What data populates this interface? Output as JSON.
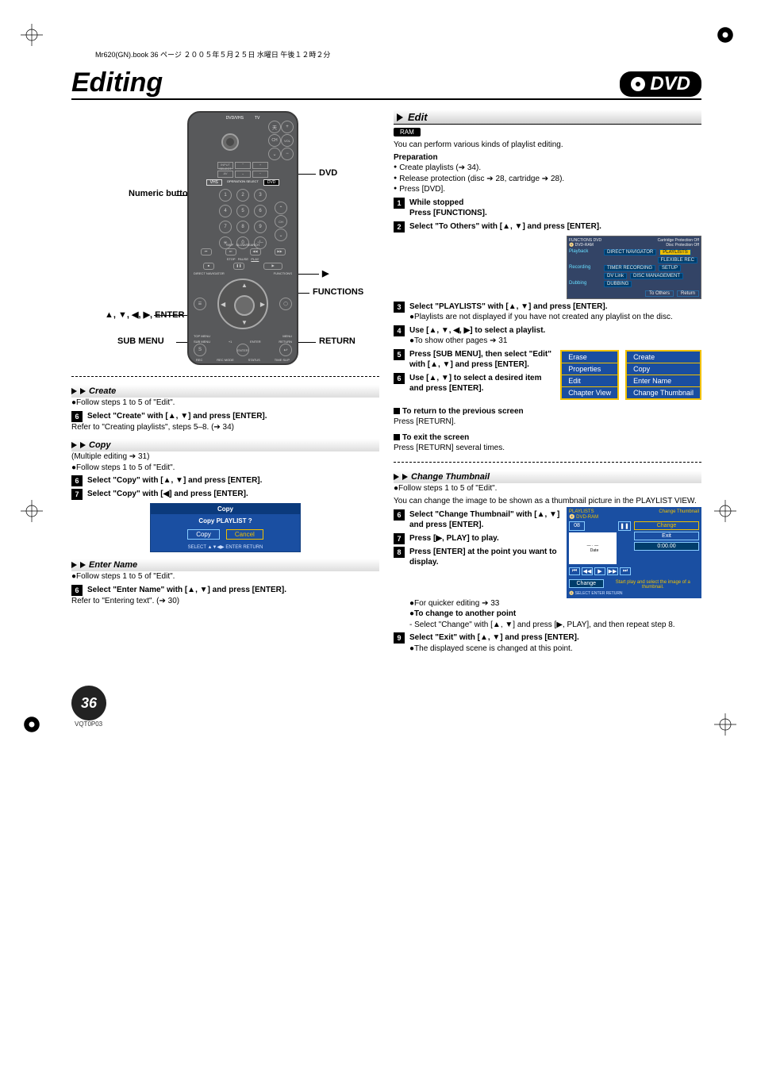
{
  "header_line": "Mr620(GN).book  36 ページ  ２００５年５月２５日  水曜日  午後１２時２分",
  "title": "Editing",
  "dvd_badge": "DVD",
  "remote": {
    "labels": {
      "numeric": "Numeric buttons",
      "dvd": "DVD",
      "play": "▶",
      "functions": "FUNCTIONS",
      "arrows": "▲, ▼, ◀, ▶, ENTER",
      "return": "RETURN",
      "submenu": "SUB MENU"
    },
    "keypad": [
      "1",
      "2",
      "3",
      "4",
      "5",
      "6",
      "7",
      "8",
      "9",
      "0"
    ],
    "mode": {
      "left": "VHS",
      "mid": "OPERATION SELECT",
      "right": "DVD"
    },
    "small": [
      "DVD/VHS",
      "TV",
      "INPUT SELECT",
      "CH",
      "VOLUME",
      "AV",
      "SKIP",
      "STOP",
      "PAUSE",
      "PLAY",
      "DIRECT NAVIGATOR",
      "TOP MENU",
      "FUNCTIONS",
      "MENU",
      "SUB MENU",
      "ENTER",
      "RETURN",
      "REC MODE",
      "REC",
      "STATUS",
      "TIME SLIP"
    ],
    "engraved": [
      "+1",
      "S"
    ]
  },
  "edit": {
    "heading": "Edit",
    "chip": "RAM",
    "intro": "You can perform various kinds of playlist editing.",
    "prep_title": "Preparation",
    "prep": [
      "Create playlists (➔ 34).",
      "Release protection (disc ➔ 28, cartridge ➔ 28).",
      "Press [DVD]."
    ],
    "steps": [
      {
        "n": "1",
        "t": "While stopped",
        "b": "Press [FUNCTIONS]."
      },
      {
        "n": "2",
        "t": "Select \"To Others\" with [▲, ▼] and press [ENTER].",
        "b": ""
      },
      {
        "n": "3",
        "t": "Select \"PLAYLISTS\" with [▲, ▼] and press [ENTER].",
        "b": "●Playlists are not displayed if you have not created any playlist on the disc."
      },
      {
        "n": "4",
        "t": "Use [▲, ▼, ◀, ▶] to select a playlist.",
        "b": "●To show other pages ➔ 31"
      },
      {
        "n": "5",
        "t": "Press [SUB MENU], then select \"Edit\" with [▲, ▼] and press [ENTER].",
        "b": ""
      },
      {
        "n": "6",
        "t": "Use [▲, ▼] to select a desired item and press [ENTER].",
        "b": ""
      }
    ],
    "osd": {
      "top_left": "FUNCTIONS",
      "top_mid": "DVD",
      "top_right_a": "Cartridge Protection Off",
      "top_right_b": "Disc Protection Off",
      "rows": [
        {
          "l": "Playback",
          "items": [
            "DIRECT NAVIGATOR",
            "PLAYLISTS",
            "FLEXIBLE REC"
          ],
          "hl": 1
        },
        {
          "l": "Recording",
          "items": [
            "TIMER RECORDING",
            "SETUP"
          ]
        },
        {
          "l": "",
          "items": [
            "DV Link",
            "DISC MANAGEMENT"
          ]
        },
        {
          "l": "Dubbing",
          "items": [
            "DUBBING"
          ]
        }
      ],
      "footer": [
        "To Others",
        "Return"
      ]
    },
    "popup_left": [
      "Erase",
      "Properties",
      "Edit",
      "Chapter View"
    ],
    "popup_right": [
      "Create",
      "Copy",
      "Enter Name",
      "Change Thumbnail"
    ],
    "return_h": "To return to the previous screen",
    "return_t": "Press [RETURN].",
    "exit_h": "To exit the screen",
    "exit_t": "Press [RETURN] several times."
  },
  "create": {
    "heading": "Create",
    "line": "●Follow steps 1 to 5 of \"Edit\".",
    "step": {
      "n": "6",
      "t": "Select \"Create\" with [▲, ▼] and press [ENTER]."
    },
    "ref": "Refer to \"Creating playlists\", steps 5–8. (➔ 34)"
  },
  "copy": {
    "heading": "Copy",
    "multi": "(Multiple editing ➔ 31)",
    "line": "●Follow steps 1 to 5 of \"Edit\".",
    "step6": {
      "n": "6",
      "t": "Select \"Copy\" with [▲, ▼] and press [ENTER]."
    },
    "step7": {
      "n": "7",
      "t": "Select \"Copy\" with [◀] and press [ENTER]."
    },
    "osd": {
      "title": "Copy",
      "q": "Copy PLAYLIST ?",
      "btns": [
        "Copy",
        "Cancel"
      ],
      "foot": "SELECT ▲▼◀▶  ENTER  RETURN"
    }
  },
  "entername": {
    "heading": "Enter Name",
    "line": "●Follow steps 1 to 5 of \"Edit\".",
    "step": {
      "n": "6",
      "t": "Select \"Enter Name\" with [▲, ▼] and press [ENTER]."
    },
    "ref": "Refer to \"Entering text\". (➔ 30)"
  },
  "changethumb": {
    "heading": "Change Thumbnail",
    "line": "●Follow steps 1 to 5 of \"Edit\".",
    "intro": "You can change the image to be shown as a thumbnail picture in the PLAYLIST VIEW.",
    "steps": [
      {
        "n": "6",
        "t": "Select \"Change Thumbnail\" with [▲, ▼] and press [ENTER]."
      },
      {
        "n": "7",
        "t": "Press [▶, PLAY] to play."
      },
      {
        "n": "8",
        "t": "Press [ENTER] at the point you want to display.",
        "b": [
          "●For quicker editing ➔ 33",
          "●To change to another point",
          "- Select \"Change\" with [▲, ▼] and press [▶, PLAY], and then repeat step 8."
        ]
      },
      {
        "n": "9",
        "t": "Select \"Exit\" with [▲, ▼] and press [ENTER].",
        "b": [
          "●The displayed scene is changed at this point."
        ]
      }
    ],
    "osd": {
      "hdr_l": "PLAYLISTS",
      "hdr_sub": "DVD-RAM",
      "hdr_r": "Change Thumbnail",
      "num": "08",
      "pause": "❚❚",
      "change": "Change",
      "exit": "Exit",
      "time": "0:00.00",
      "pbtns": [
        "⏮",
        "◀◀",
        "▶",
        "▶▶",
        "⏭"
      ],
      "btn_change": "Change",
      "hint": "Start play and select the image of a thumbnail.",
      "ft": "SELECT  ENTER  RETURN"
    }
  },
  "page": {
    "num": "36",
    "code": "VQT0P03"
  }
}
